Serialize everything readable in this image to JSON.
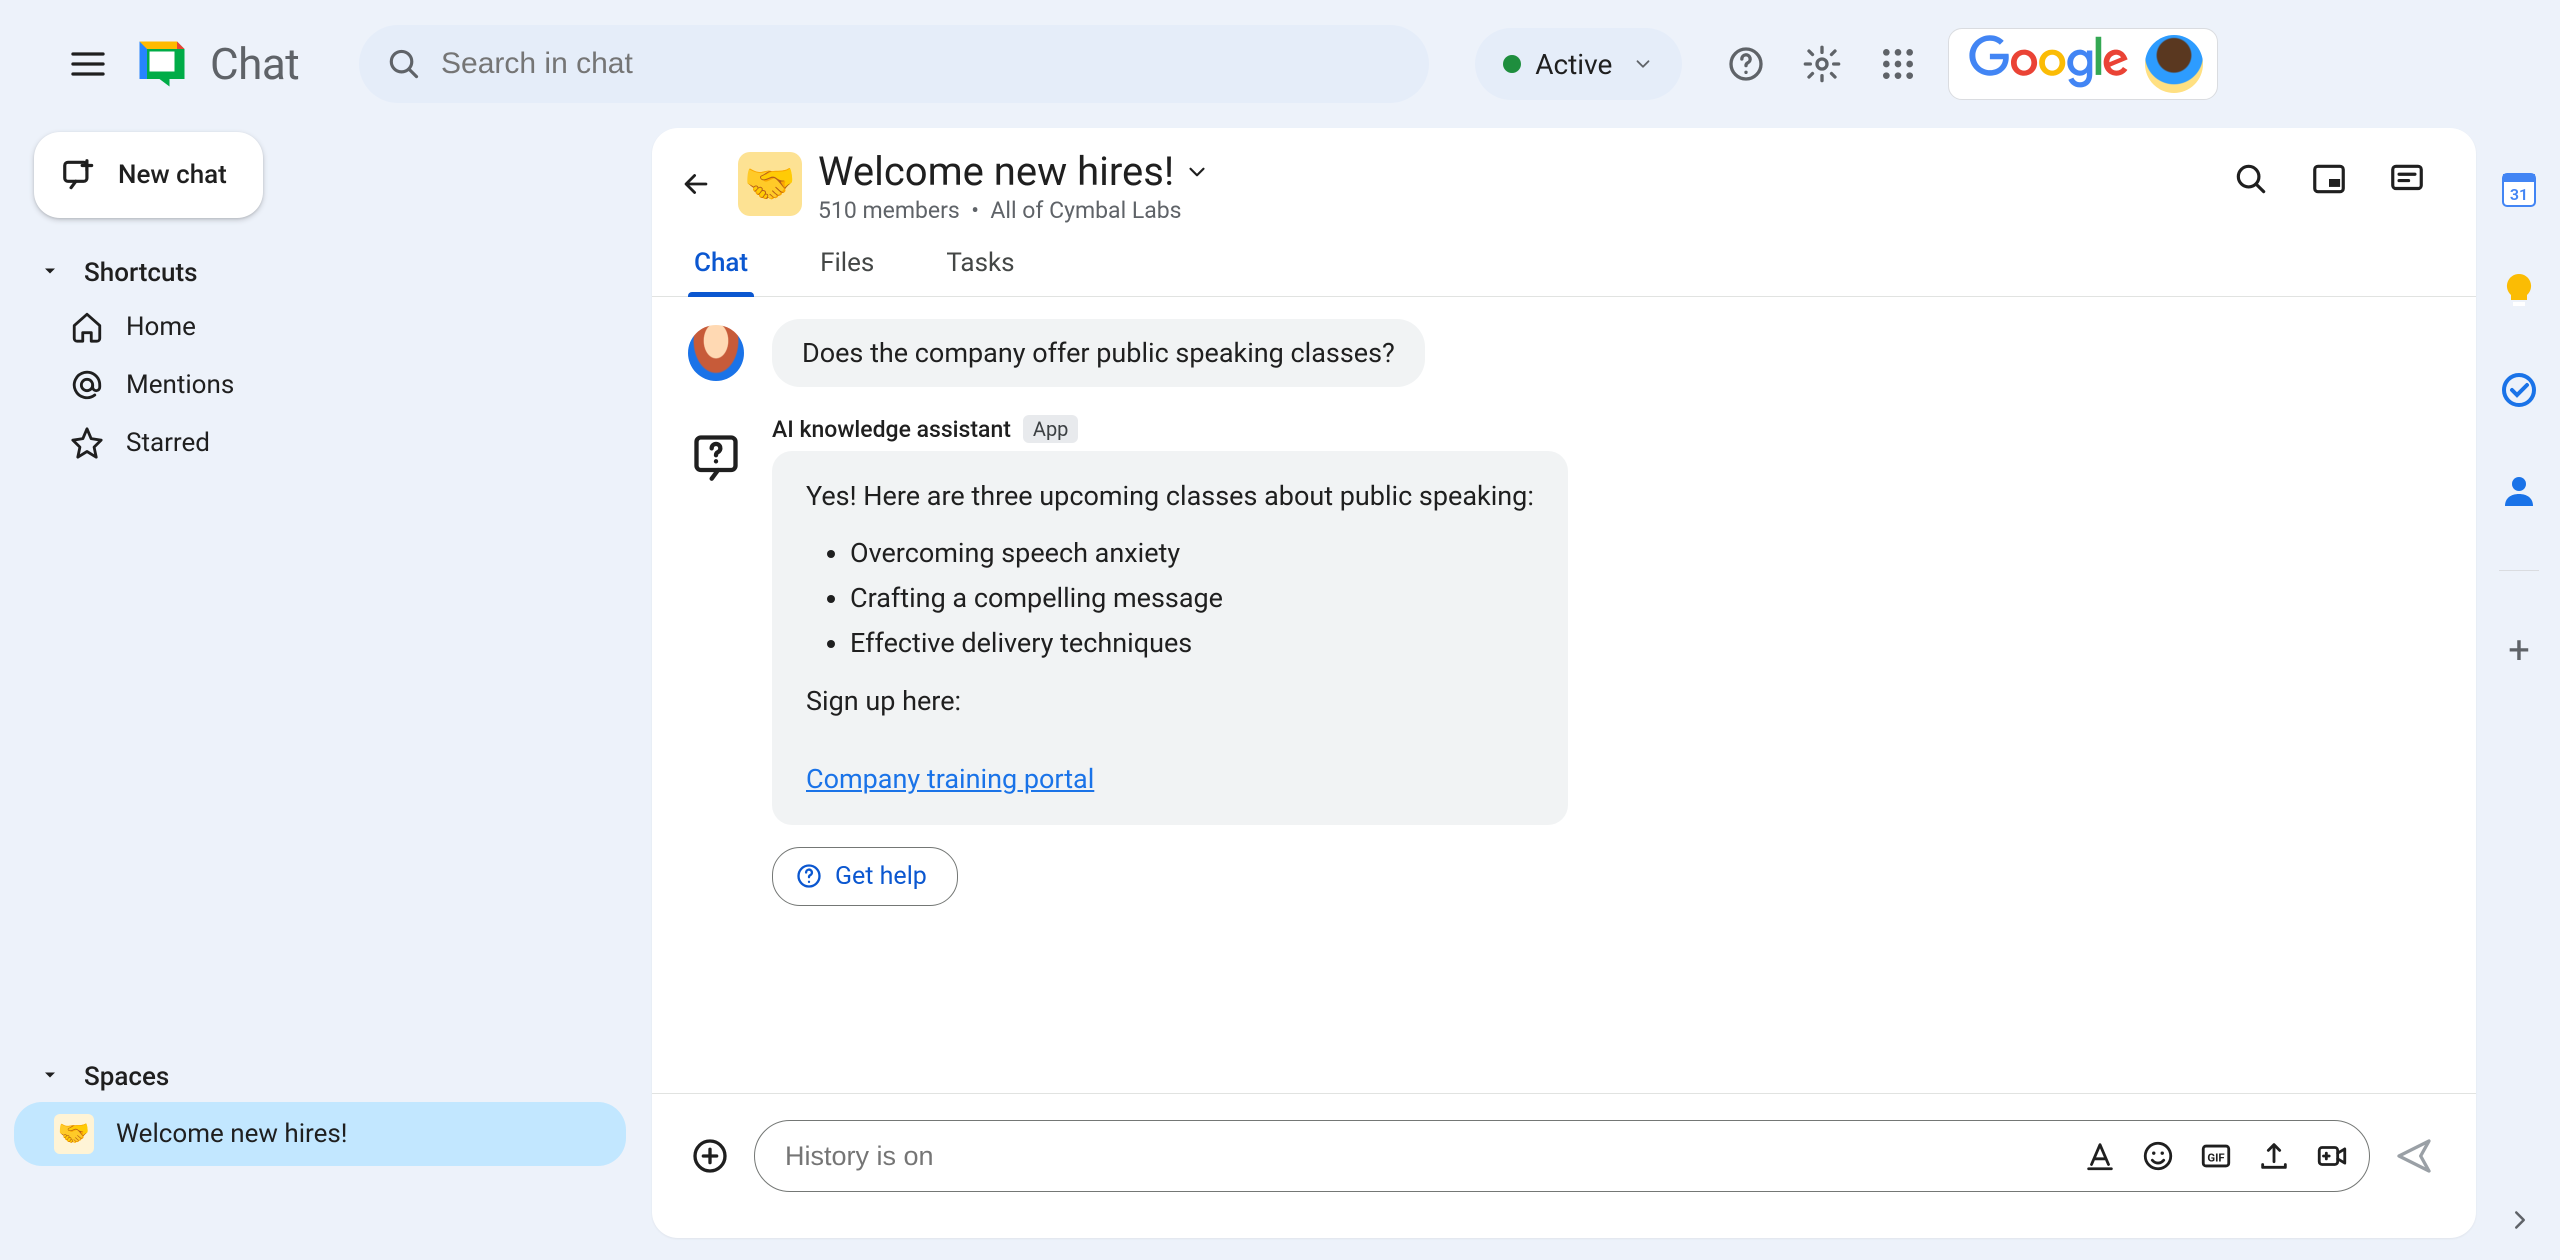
{
  "app": {
    "name": "Chat"
  },
  "search": {
    "placeholder": "Search in chat"
  },
  "status": {
    "label": "Active"
  },
  "google_logo_text": "Google",
  "sidebar": {
    "new_chat": "New chat",
    "shortcuts_header": "Shortcuts",
    "home": "Home",
    "mentions": "Mentions",
    "starred": "Starred",
    "spaces_header": "Spaces",
    "space_welcome": "Welcome new hires!"
  },
  "conv": {
    "title": "Welcome new hires!",
    "members": "510 members",
    "bullet": "•",
    "org": "All of Cymbal Labs",
    "tabs": {
      "chat": "Chat",
      "files": "Files",
      "tasks": "Tasks"
    }
  },
  "messages": {
    "user_question": "Does the company offer public speaking classes?",
    "bot_name": "AI knowledge assistant",
    "app_chip": "App",
    "bot_intro": "Yes! Here are three upcoming classes about public speaking:",
    "bot_items": [
      "Overcoming speech anxiety",
      "Crafting a compelling message",
      "Effective delivery techniques"
    ],
    "bot_signup": "Sign up here:",
    "bot_link": "Company training portal",
    "get_help": "Get help"
  },
  "composer": {
    "placeholder": "History is on"
  }
}
